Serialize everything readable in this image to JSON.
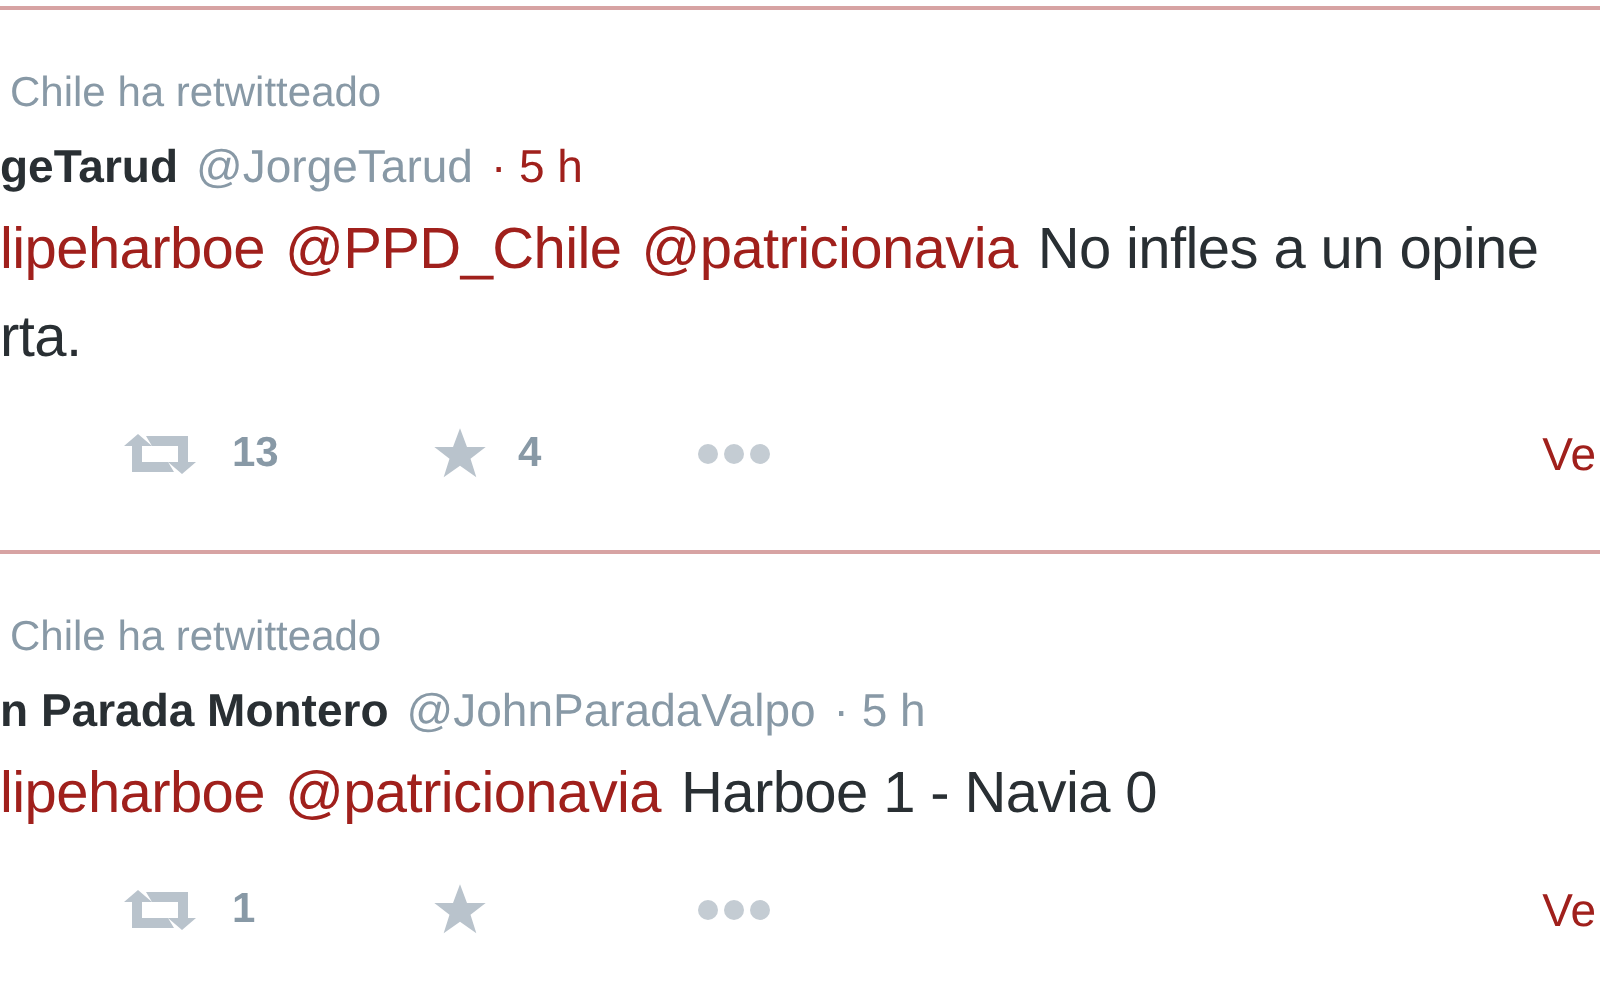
{
  "tweets": [
    {
      "retweet_context": "Chile ha retwitteado",
      "name": "geTarud",
      "handle": "@JorgeTarud",
      "time": "· 5 h",
      "time_highlighted": true,
      "lines": [
        [
          {
            "kind": "mention",
            "text": "lipeharboe"
          },
          {
            "kind": "mention",
            "text": "@PPD_Chile"
          },
          {
            "kind": "mention",
            "text": "@patricionavia"
          },
          {
            "kind": "text",
            "text": "No infles a un opine"
          }
        ],
        [
          {
            "kind": "text",
            "text": "rta."
          }
        ]
      ],
      "retweets": "13",
      "favorites": "4",
      "link": "Ve"
    },
    {
      "retweet_context": "Chile ha retwitteado",
      "name": "n Parada Montero",
      "handle": "@JohnParadaValpo",
      "time": "· 5 h",
      "time_highlighted": false,
      "lines": [
        [
          {
            "kind": "mention",
            "text": "lipeharboe"
          },
          {
            "kind": "mention",
            "text": "@patricionavia"
          },
          {
            "kind": "text",
            "text": "Harboe 1 - Navia 0"
          }
        ]
      ],
      "retweets": "1",
      "link": "Ve"
    }
  ]
}
